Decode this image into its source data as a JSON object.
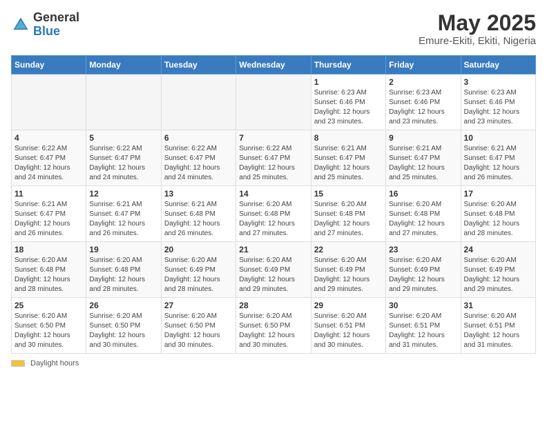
{
  "logo": {
    "general": "General",
    "blue": "Blue"
  },
  "title": "May 2025",
  "subtitle": "Emure-Ekiti, Ekiti, Nigeria",
  "days_of_week": [
    "Sunday",
    "Monday",
    "Tuesday",
    "Wednesday",
    "Thursday",
    "Friday",
    "Saturday"
  ],
  "footer": {
    "daylight_label": "Daylight hours"
  },
  "weeks": [
    [
      {
        "day": "",
        "info": ""
      },
      {
        "day": "",
        "info": ""
      },
      {
        "day": "",
        "info": ""
      },
      {
        "day": "",
        "info": ""
      },
      {
        "day": "1",
        "info": "Sunrise: 6:23 AM\nSunset: 6:46 PM\nDaylight: 12 hours\nand 23 minutes."
      },
      {
        "day": "2",
        "info": "Sunrise: 6:23 AM\nSunset: 6:46 PM\nDaylight: 12 hours\nand 23 minutes."
      },
      {
        "day": "3",
        "info": "Sunrise: 6:23 AM\nSunset: 6:46 PM\nDaylight: 12 hours\nand 23 minutes."
      }
    ],
    [
      {
        "day": "4",
        "info": "Sunrise: 6:22 AM\nSunset: 6:47 PM\nDaylight: 12 hours\nand 24 minutes."
      },
      {
        "day": "5",
        "info": "Sunrise: 6:22 AM\nSunset: 6:47 PM\nDaylight: 12 hours\nand 24 minutes."
      },
      {
        "day": "6",
        "info": "Sunrise: 6:22 AM\nSunset: 6:47 PM\nDaylight: 12 hours\nand 24 minutes."
      },
      {
        "day": "7",
        "info": "Sunrise: 6:22 AM\nSunset: 6:47 PM\nDaylight: 12 hours\nand 25 minutes."
      },
      {
        "day": "8",
        "info": "Sunrise: 6:21 AM\nSunset: 6:47 PM\nDaylight: 12 hours\nand 25 minutes."
      },
      {
        "day": "9",
        "info": "Sunrise: 6:21 AM\nSunset: 6:47 PM\nDaylight: 12 hours\nand 25 minutes."
      },
      {
        "day": "10",
        "info": "Sunrise: 6:21 AM\nSunset: 6:47 PM\nDaylight: 12 hours\nand 26 minutes."
      }
    ],
    [
      {
        "day": "11",
        "info": "Sunrise: 6:21 AM\nSunset: 6:47 PM\nDaylight: 12 hours\nand 26 minutes."
      },
      {
        "day": "12",
        "info": "Sunrise: 6:21 AM\nSunset: 6:47 PM\nDaylight: 12 hours\nand 26 minutes."
      },
      {
        "day": "13",
        "info": "Sunrise: 6:21 AM\nSunset: 6:48 PM\nDaylight: 12 hours\nand 26 minutes."
      },
      {
        "day": "14",
        "info": "Sunrise: 6:20 AM\nSunset: 6:48 PM\nDaylight: 12 hours\nand 27 minutes."
      },
      {
        "day": "15",
        "info": "Sunrise: 6:20 AM\nSunset: 6:48 PM\nDaylight: 12 hours\nand 27 minutes."
      },
      {
        "day": "16",
        "info": "Sunrise: 6:20 AM\nSunset: 6:48 PM\nDaylight: 12 hours\nand 27 minutes."
      },
      {
        "day": "17",
        "info": "Sunrise: 6:20 AM\nSunset: 6:48 PM\nDaylight: 12 hours\nand 28 minutes."
      }
    ],
    [
      {
        "day": "18",
        "info": "Sunrise: 6:20 AM\nSunset: 6:48 PM\nDaylight: 12 hours\nand 28 minutes."
      },
      {
        "day": "19",
        "info": "Sunrise: 6:20 AM\nSunset: 6:48 PM\nDaylight: 12 hours\nand 28 minutes."
      },
      {
        "day": "20",
        "info": "Sunrise: 6:20 AM\nSunset: 6:49 PM\nDaylight: 12 hours\nand 28 minutes."
      },
      {
        "day": "21",
        "info": "Sunrise: 6:20 AM\nSunset: 6:49 PM\nDaylight: 12 hours\nand 29 minutes."
      },
      {
        "day": "22",
        "info": "Sunrise: 6:20 AM\nSunset: 6:49 PM\nDaylight: 12 hours\nand 29 minutes."
      },
      {
        "day": "23",
        "info": "Sunrise: 6:20 AM\nSunset: 6:49 PM\nDaylight: 12 hours\nand 29 minutes."
      },
      {
        "day": "24",
        "info": "Sunrise: 6:20 AM\nSunset: 6:49 PM\nDaylight: 12 hours\nand 29 minutes."
      }
    ],
    [
      {
        "day": "25",
        "info": "Sunrise: 6:20 AM\nSunset: 6:50 PM\nDaylight: 12 hours\nand 30 minutes."
      },
      {
        "day": "26",
        "info": "Sunrise: 6:20 AM\nSunset: 6:50 PM\nDaylight: 12 hours\nand 30 minutes."
      },
      {
        "day": "27",
        "info": "Sunrise: 6:20 AM\nSunset: 6:50 PM\nDaylight: 12 hours\nand 30 minutes."
      },
      {
        "day": "28",
        "info": "Sunrise: 6:20 AM\nSunset: 6:50 PM\nDaylight: 12 hours\nand 30 minutes."
      },
      {
        "day": "29",
        "info": "Sunrise: 6:20 AM\nSunset: 6:51 PM\nDaylight: 12 hours\nand 30 minutes."
      },
      {
        "day": "30",
        "info": "Sunrise: 6:20 AM\nSunset: 6:51 PM\nDaylight: 12 hours\nand 31 minutes."
      },
      {
        "day": "31",
        "info": "Sunrise: 6:20 AM\nSunset: 6:51 PM\nDaylight: 12 hours\nand 31 minutes."
      }
    ]
  ]
}
